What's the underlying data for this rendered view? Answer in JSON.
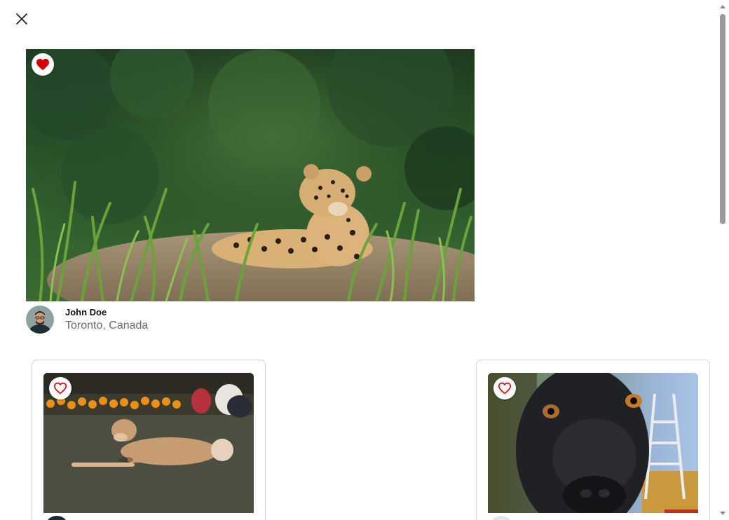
{
  "modal": {
    "close_icon": "close-icon"
  },
  "main_post": {
    "photo_subject": "jaguar",
    "liked": true,
    "like_icon": "heart-filled-icon",
    "like_color": "#d60000",
    "author": {
      "name": "John Doe",
      "location": "Toronto, Canada"
    }
  },
  "related_posts": [
    {
      "photo_subject": "dog",
      "liked": false,
      "like_icon": "heart-outline-icon",
      "like_color": "#d60000"
    },
    {
      "photo_subject": "dog",
      "liked": false,
      "like_icon": "heart-outline-icon",
      "like_color": "#d60000"
    }
  ]
}
